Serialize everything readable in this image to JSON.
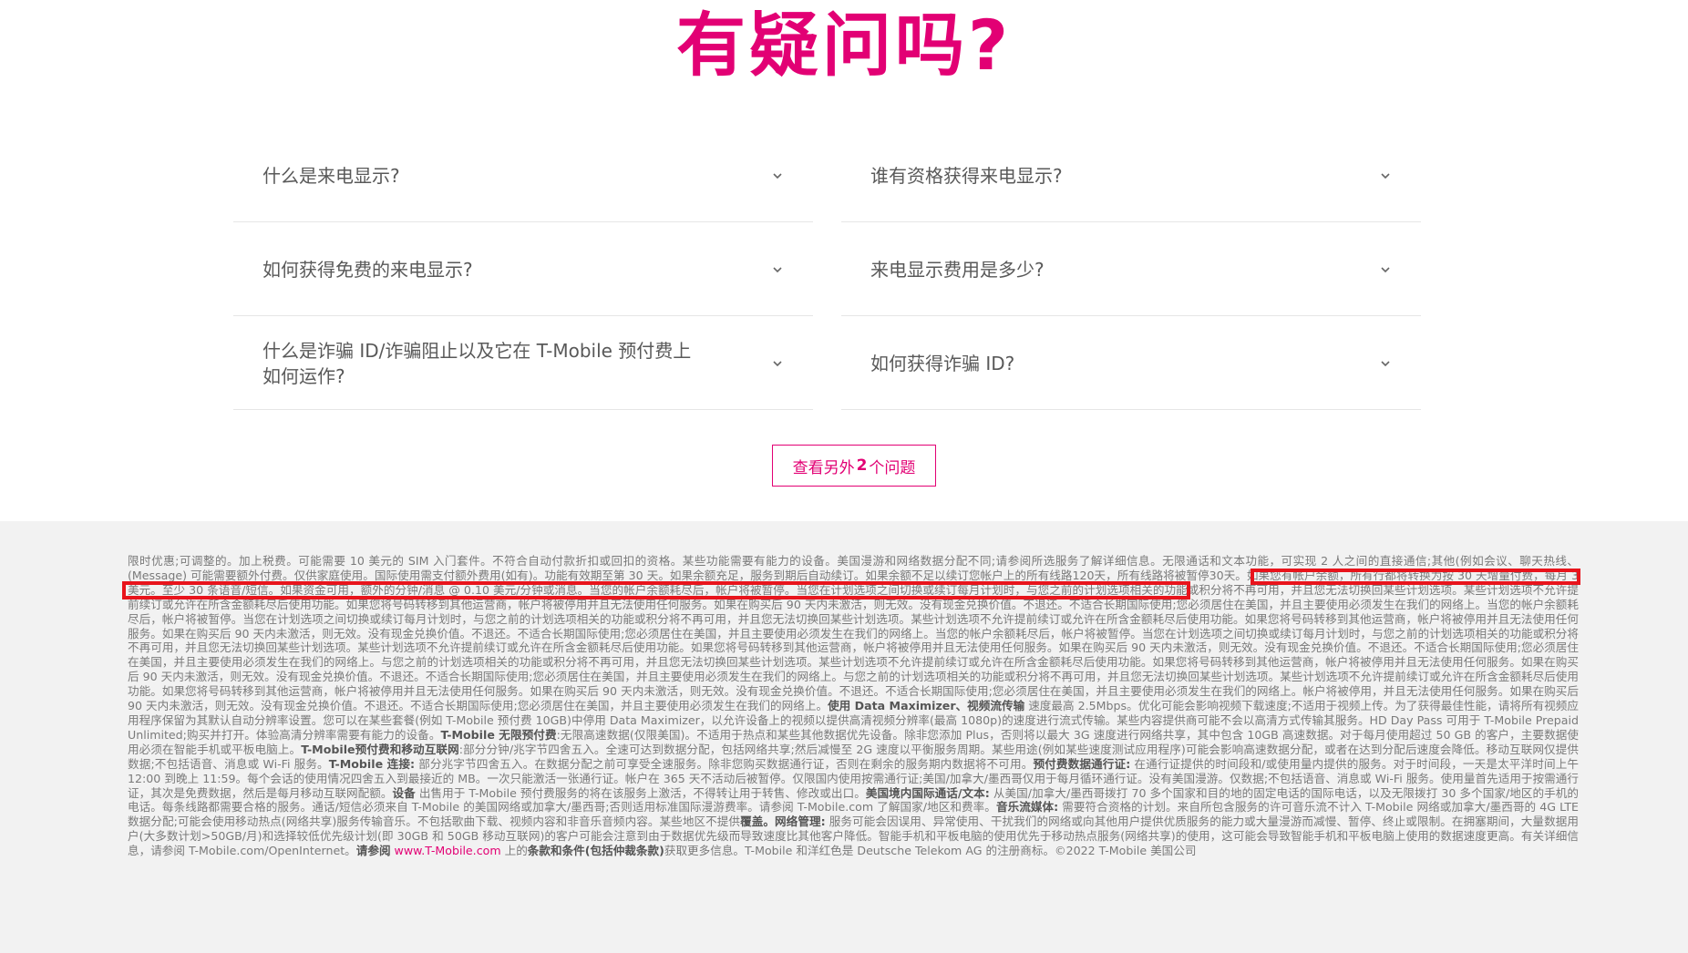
{
  "colors": {
    "brand_magenta": "#e20074",
    "highlight_red": "#e8141c",
    "legal_bg": "#f2f2f2"
  },
  "faq": {
    "title": "有疑问吗?",
    "items": [
      {
        "question": "什么是来电显示?",
        "icon": "chevron-down-icon"
      },
      {
        "question": "谁有资格获得来电显示?",
        "icon": "chevron-down-icon"
      },
      {
        "question": "如何获得免费的来电显示?",
        "icon": "chevron-down-icon"
      },
      {
        "question": "来电显示费用是多少?",
        "icon": "chevron-down-icon"
      },
      {
        "question": "什么是诈骗 ID/诈骗阻止以及它在 T-Mobile 预付费上如何运作?",
        "icon": "chevron-down-icon"
      },
      {
        "question": "如何获得诈骗 ID?",
        "icon": "chevron-down-icon"
      }
    ],
    "more_button": {
      "prefix": "查看另外",
      "count": "2",
      "suffix": "个问题"
    }
  },
  "legal": {
    "p1": "限时优惠;可调整的。加上税费。可能需要 10 美元的 SIM 入门套件。不符合自动付款折扣或回扣的资格。某些功能需要有能力的设备。美国漫游和网络数据分配不同;请参阅所选服务了解详细信息。无限通话和文本功能，可实现 2 人之间的直接通信;其他(例如会议、聊天热线、(Message) 可能需要额外付费。仅供家庭使用。国际使用需支付额外费用(如有)。功能有效期至第 30 天。如果余额充足，服务到期后自动续订。",
    "highlight1": "如果余额不足以续订您帐户上的所有线路120天，所有线路将被暂停30天。如果您有帐户余额，所有行都将转换为按 30 天增量付费，每月 3 美元。至少 30 条语音/短信。如果资金可用，额外的分钟/消息 @ 0.10 美元/分钟或消息。",
    "p2": "当您的帐户余额耗尽后，帐户将被暂停。当您在计划选项之间切换或续订每月计划时，与您之前的计划选项相关的功能或积分将不再可用，并且您无法切换回某些计划选项。某些计划选项不允许提前续订或允许在所含金额耗尽后使用功能。如果您将号码转移到其他运营商，帐户将被停用并且无法使用任何服务。如果在购买后 90 天内未激活，则无效。没有现金兑换价值。不退还。不适合长期国际使用;您必须居住在美国，并且主要使用必须发生在我们的网络上。当您的帐户余额耗尽后，帐户将被暂停。当您在计划选项之间切换或续订每月计划时，与您之前的计划选项相关的功能或积分将不再可用，并且您无法切换回某些计划选项。某些计划选项不允许提前续订或允许在所含金额耗尽后使用功能。如果您将号码转移到其他运营商，帐户将被停用并且无法使用任何服务。如果在购买后 90 天内未激活，则无效。没有现金兑换价值。不退还。不适合长期国际使用;您必须居住在美国，并且主要使用必须发生在我们的网络上。当您的帐户余额耗尽后，帐户将被暂停。当您在计划选项之间切换或续订每月计划时，与您之前的计划选项相关的功能或积分将不再可用，并且您无法切换回某些计划选项。某些计划选项不允许提前续订或允许在所含金额耗尽后使用功能。如果您将号码转移到其他运营商，帐户将被停用并且无法使用任何服务。如果在购买后 90 天内未激活，则无效。没有现金兑换价值。不退还。不适合长期国际使用;您必须居住在美国，并且主要使用必须发生在我们的网络上。与您之前的计划选项相关的功能或积分将不再可用，并且您无法切换回某些计划选项。某些计划选项不允许提前续订或允许在所含金额耗尽后使用功能。如果您将号码转移到其他运营商，帐户将被停用并且无法使用任何服务。如果在购买后 90 天内未激活，则无效。没有现金兑换价值。不退还。不适合长期国际使用;您必须居住在美国，并且主要使用必须发生在我们的网络上。与您之前的计划选项相关的功能或积分将不再可用，并且您无法切换回某些计划选项。某些计划选项不允许提前续订或允许在所含金额耗尽后使用功能。如果您将号码转移到其他运营商，帐户将被停用并且无法使用任何服务。如果在购买后 90 天内未激活，则无效。没有现金兑换价值。不退还。不适合长期国际使用;您必须居住在美国，并且主要使用必须发生在我们的网络上。帐户将被停用，并且无法使用任何服务。如果在购买后 90 天内未激活，则无效。没有现金兑换价值。不退还。不适合长期国际使用;您必须居住在美国，并且主要使用必须发生在我们的网络上。",
    "dm_label": "使用 Data Maximizer、视频流传输",
    "p3": " 速度最高 2.5Mbps。优化可能会影响视频下载速度;不适用于视频上传。为了获得最佳性能，请将所有视频应用程序保留为其默认自动分辨率设置。您可以在某些套餐(例如 T-Mobile 预付费 10GB)中停用 Data Maximizer，以允许设备上的视频以提供高清视频分辨率(最高 1080p)的速度进行流式传输。某些内容提供商可能不会以高清方式传输其服务。HD Day Pass 可用于 T-Mobile Prepaid Unlimited;购买并打开。体验高清分辨率需要有能力的设备。",
    "unl_label": "T-Mobile 无限预付费",
    "p4": ":无限高速数据(仅限美国)。不适用于热点和某些其他数据优先设备。除非您添加 Plus，否则将以最大 3G 速度进行网络共享，其中包含 10GB 高速数据。对于每月使用超过 50 GB 的客户，主要数据使用必须在智能手机或平板电脑上。",
    "pp_label": "T-Mobile预付费和移动互联网",
    "p5": ":部分分钟/兆字节四舍五入。全速可达到数据分配，包括网络共享;然后减慢至 2G 速度以平衡服务周期。某些用途(例如某些速度测试应用程序)可能会影响高速数据分配，或者在达到分配后速度会降低。移动互联网仅提供数据;不包括语音、消息或 Wi-Fi 服务。",
    "conn_label": "T-Mobile 连接:",
    "p6": " 部分兆字节四舍五入。在数据分配之前可享受全速服务。除非您购买数据通行证，否则在剩余的服务期内数据将不可用。",
    "pass_label": "预付费数据通行证:",
    "p7": " 在通行证提供的时间段和/或使用量内提供的服务。对于时间段，一天是太平洋时间上午 12:00 到晚上 11:59。每个会话的使用情况四舍五入到最接近的 MB。一次只能激活一张通行证。帐户在 365 天不活动后被暂停。仅限国内使用按需通行证;美国/加拿大/墨西哥仅用于每月循环通行证。没有美国漫游。仅数据;不包括语音、消息或 Wi-Fi 服务。使用量首先适用于按需通行证，其次是免费数据，然后是每月移动互联网配额。",
    "dev_label": "设备",
    "p8": " 出售用于 T-Mobile 预付费服务的将在该服务上激活，不得转让用于转售、修改或出口。",
    "intl_label": "美国境内国际通话/文本:",
    "p9": " 从美国/加拿大/墨西哥拨打 70 多个国家和目的地的固定电话的国际电话，以及无限拨打 30 多个国家/地区的手机的电话。每条线路都需要合格的服务。通话/短信必须来自 T-Mobile 的美国网络或加拿大/墨西哥;否则适用标准国际漫游费率。请参阅 T-Mobile.com 了解国家/地区和费率。",
    "music_label": "音乐流媒体:",
    "p10": " 需要符合资格的计划。来自所包含服务的许可音乐流不计入 T-Mobile 网络或加拿大/墨西哥的 4G LTE 数据分配;可能会使用移动热点(网络共享)服务传输音乐。不包括歌曲下载、视频内容和非音乐音频内容。某些地区不提供",
    "cov_label": "覆盖。网络管理:",
    "p11": " 服务可能会因误用、异常使用、干扰我们的网络或向其他用户提供优质服务的能力或大量漫游而减慢、暂停、终止或限制。在拥塞期间，大量数据用户(大多数计划>50GB/月)和选择较低优先级计划(即 30GB 和 50GB 移动互联网)的客户可能会注意到由于数据优先级而导致速度比其他客户降低。智能手机和平板电脑的使用优先于移动热点服务(网络共享)的使用，这可能会导致智能手机和平板电脑上使用的数据速度更高。有关详细信息，请参阅 T-Mobile.com/OpenInternet。",
    "see_label": "请参阅",
    "link_text": "www.T-Mobile.com",
    "p12": " 上的",
    "terms_label": "条款和条件(包括仲裁条款)",
    "p13": "获取更多信息。T-Mobile 和洋红色是 Deutsche Telekom AG 的注册商标。©2022 T-Mobile 美国公司"
  }
}
